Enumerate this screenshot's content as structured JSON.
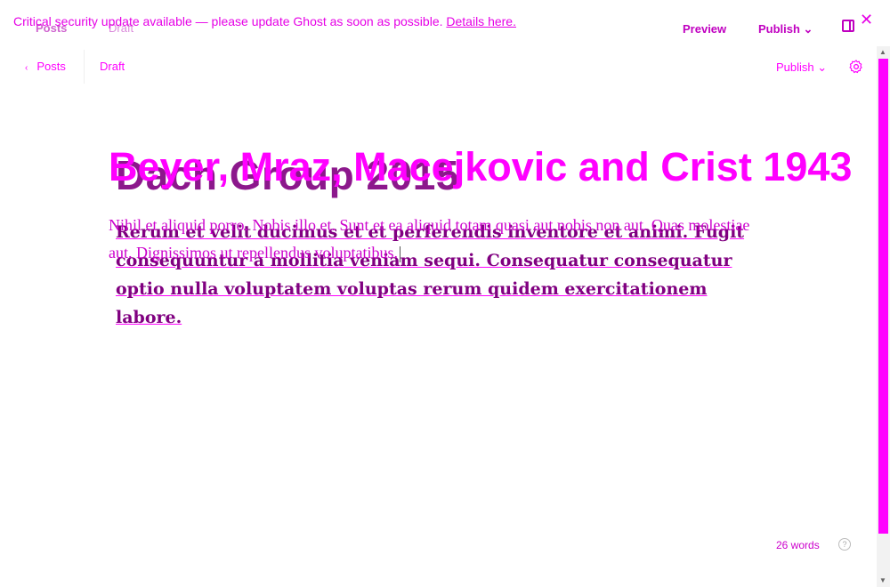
{
  "banner": {
    "message": "Critical security update available — please update Ghost as soon as possible.",
    "link": "Details here."
  },
  "background_header": {
    "posts": "Posts",
    "draft": "Draft",
    "preview": "Preview",
    "publish": "Publish ⌄",
    "close": "✕"
  },
  "background_post": {
    "title": "Dach Group 2015",
    "body": "Rerum et velit ducimus et et perferendis inventore et animi. Fugit consequuntur a mollitia veniam sequi. Consequatur consequatur optio nulla voluptatem voluptas rerum quidem exercitationem labore."
  },
  "header": {
    "back_label": "Posts",
    "back_chevron": "‹",
    "status": "Draft",
    "publish_label": "Publish ⌄"
  },
  "post": {
    "title": "Beyer, Mraz, Macejkovic and Crist 1943",
    "body": "Nihil et aliquid porro. Nobis illo et. Sunt et ea aliquid totam quasi aut nobis non aut. Quas molestiae aut. Dignissimos ut repellendus voluptatibus."
  },
  "footer": {
    "word_count": "26 words",
    "help": "?"
  },
  "scrollbar": {
    "up": "▲",
    "down": "▼"
  },
  "colors": {
    "accent": "#ff00ff",
    "dark_accent": "#800080"
  }
}
